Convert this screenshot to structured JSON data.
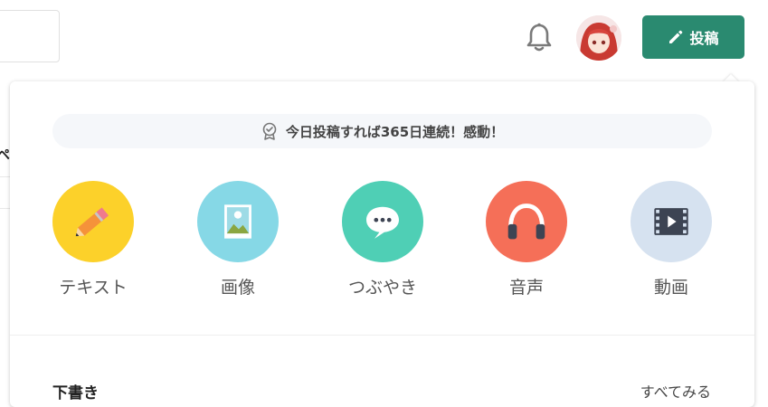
{
  "header": {
    "post_button_label": "投稿",
    "accent_color": "#2a8a70"
  },
  "background_fragment": {
    "partial_text": "ペ"
  },
  "panel": {
    "streak_banner": "今日投稿すれば365日連続！感動！",
    "post_types": [
      {
        "label": "テキスト",
        "icon": "pencil-icon",
        "color": "#fcd12a"
      },
      {
        "label": "画像",
        "icon": "image-icon",
        "color": "#86d8e6"
      },
      {
        "label": "つぶやき",
        "icon": "chat-bubble-icon",
        "color": "#4fcfb5"
      },
      {
        "label": "音声",
        "icon": "headphones-icon",
        "color": "#f56f58"
      },
      {
        "label": "動画",
        "icon": "film-icon",
        "color": "#d6e2f0"
      }
    ],
    "drafts_title": "下書き",
    "see_all_label": "すべてみる"
  }
}
